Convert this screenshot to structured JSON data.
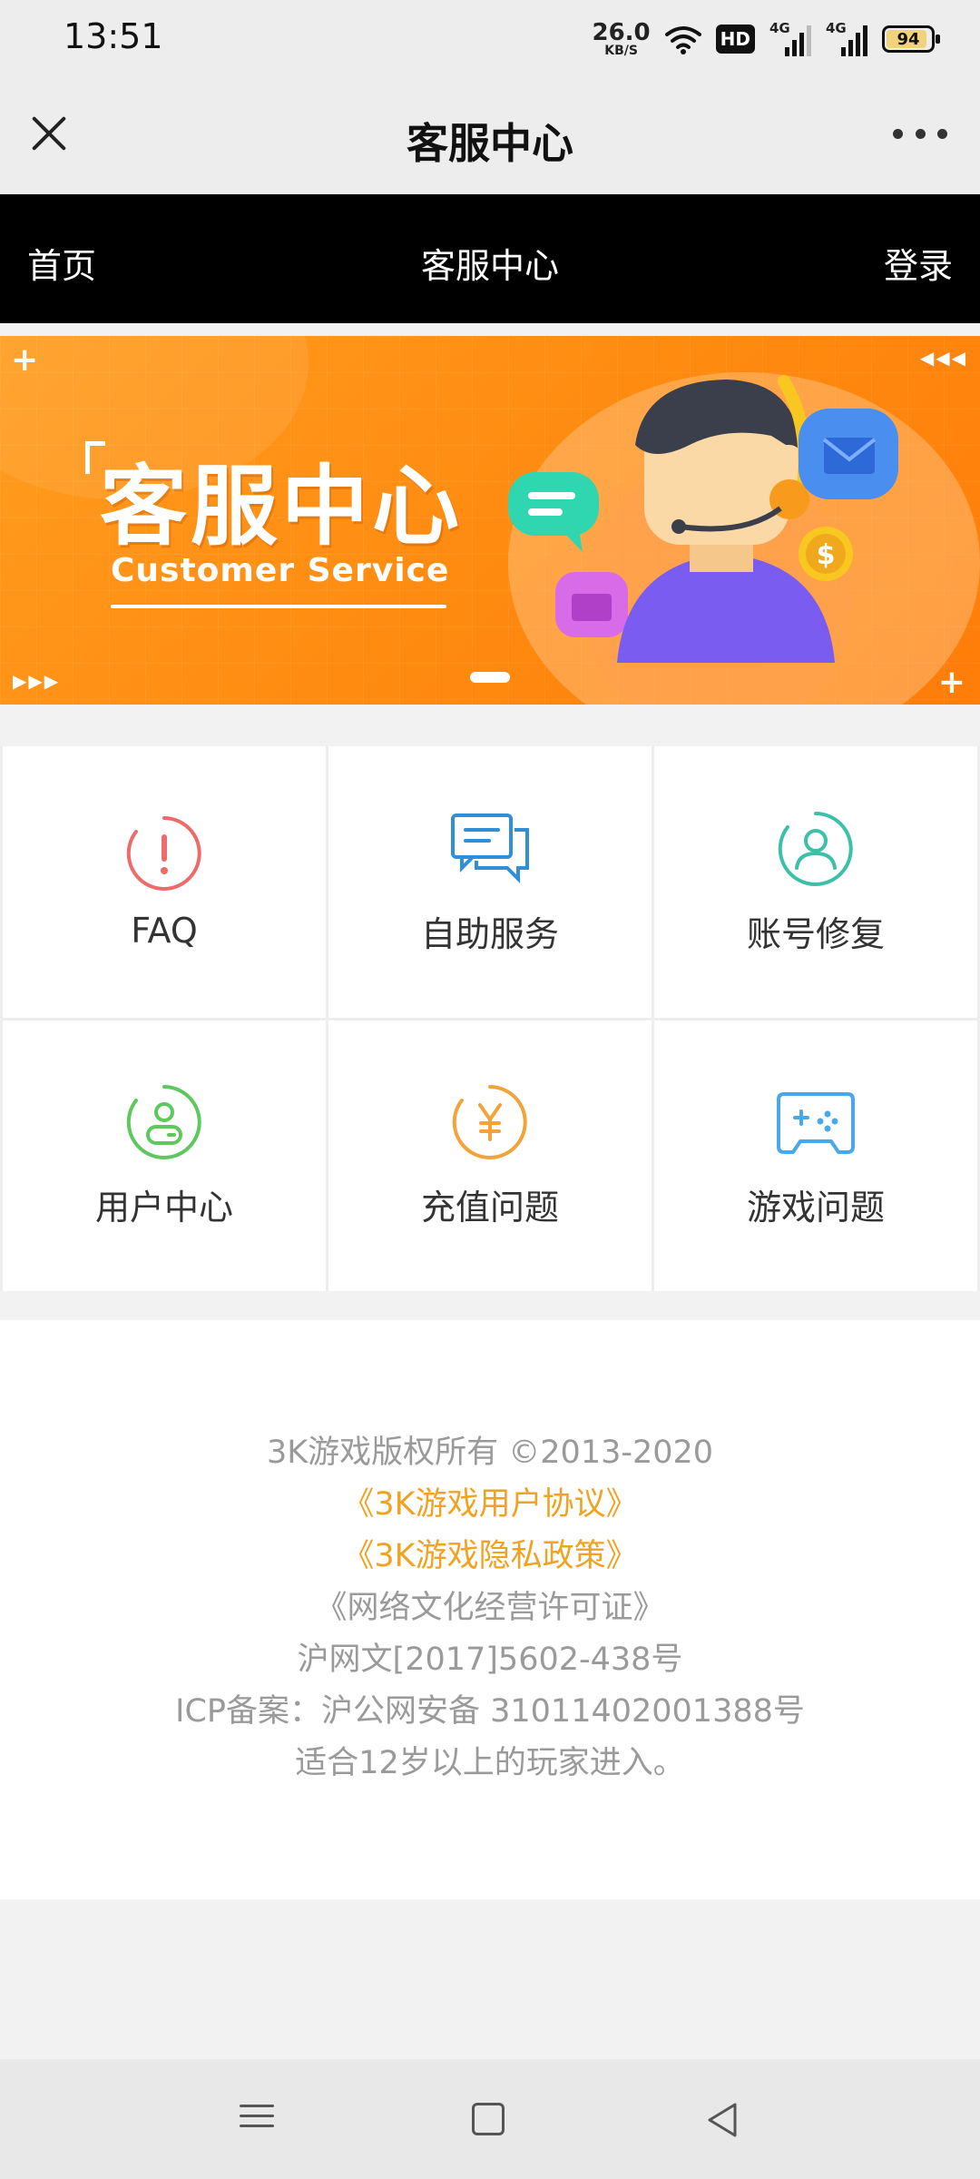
{
  "status_bar": {
    "time": "13:51",
    "net_speed_value": "26.0",
    "net_speed_unit": "KB/S",
    "hd_label": "HD",
    "sim1_label": "4G",
    "sim2_label": "4G",
    "battery_level": "94",
    "icons": [
      "wifi-icon",
      "hd-icon",
      "signal-icon",
      "signal-icon",
      "battery-icon"
    ]
  },
  "title_bar": {
    "title": "客服中心",
    "close_icon": "close-icon",
    "more_icon": "more-icon"
  },
  "header": {
    "home_label": "首页",
    "title": "客服中心",
    "login_label": "登录"
  },
  "banner": {
    "title": "客服中心",
    "subtitle": "Customer Service",
    "slide_index": 1,
    "colors": {
      "bg_start": "#ff9d1f",
      "bg_end": "#ff7d0a"
    }
  },
  "services": [
    {
      "label": "FAQ",
      "icon": "alert-circle-icon",
      "color": "#ee6b6b"
    },
    {
      "label": "自助服务",
      "icon": "chat-bubbles-icon",
      "color": "#2f8fd8"
    },
    {
      "label": "账号修复",
      "icon": "user-circle-icon",
      "color": "#3cc0a8"
    },
    {
      "label": "用户中心",
      "icon": "user-center-icon",
      "color": "#5ec85e"
    },
    {
      "label": "充值问题",
      "icon": "yuan-coin-icon",
      "color": "#f2a33a"
    },
    {
      "label": "游戏问题",
      "icon": "gamepad-icon",
      "color": "#4aa8e8"
    }
  ],
  "footer": {
    "copyright": "3K游戏版权所有 ©2013-2020",
    "user_agreement": "《3K游戏用户协议》",
    "privacy_policy": "《3K游戏隐私政策》",
    "culture_license": "《网络文化经营许可证》",
    "license_number": "沪网文[2017]5602-438号",
    "icp": "ICP备案：沪公网安备 31011402001388号",
    "age_notice": "适合12岁以上的玩家进入。",
    "link_color": "#f0a322"
  },
  "system_nav": {
    "menu_icon": "menu-icon",
    "home_icon": "home-square-icon",
    "back_icon": "back-triangle-icon"
  }
}
